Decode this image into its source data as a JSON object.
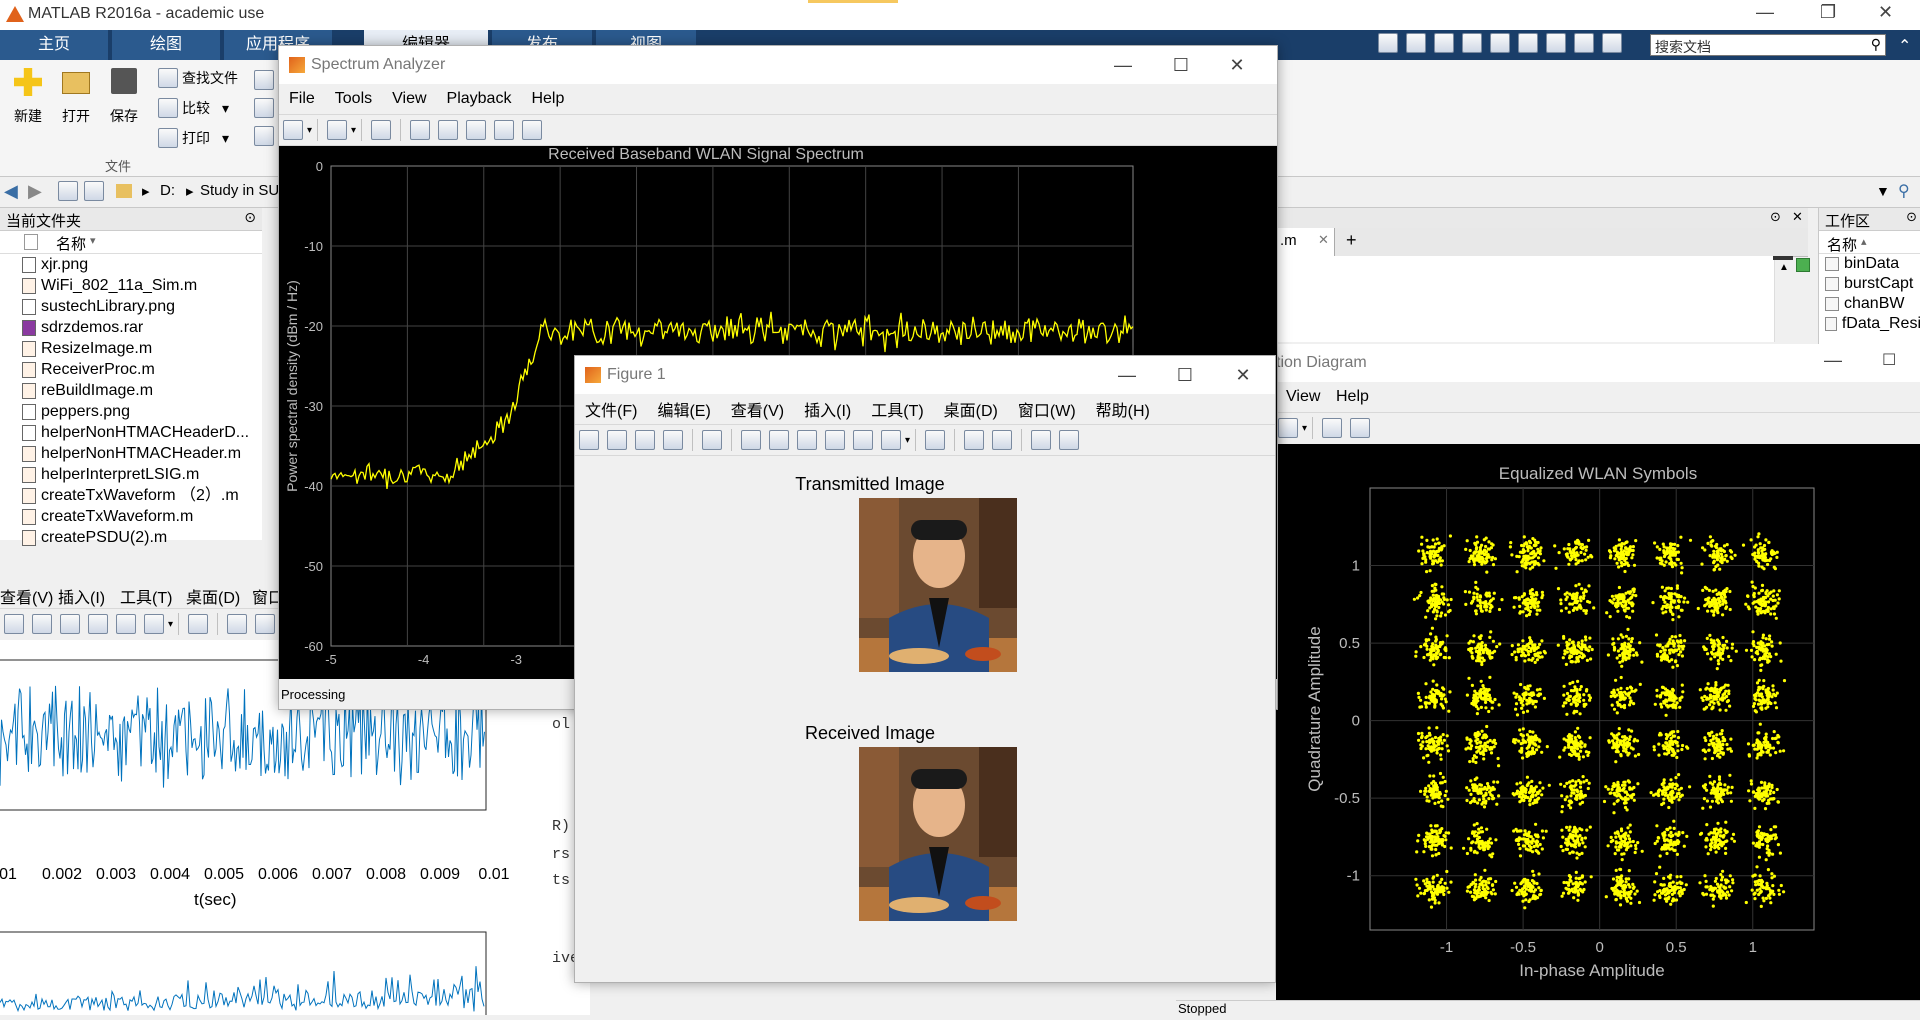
{
  "app": {
    "title": "MATLAB R2016a - academic use",
    "tabs": [
      "主页",
      "绘图",
      "应用程序",
      "编辑器",
      "发布",
      "视图"
    ],
    "search_placeholder": "搜索文档",
    "file_buttons": {
      "new": "新建",
      "open": "打开",
      "save": "保存",
      "find_files": "查找文件",
      "compare": "比较",
      "print": "打印",
      "section": "文件"
    },
    "path": {
      "drive": "D:",
      "folder": "Study in SU"
    },
    "current_folder": {
      "title": "当前文件夹",
      "column": "名称",
      "files": [
        "xjr.png",
        "WiFi_802_11a_Sim.m",
        "sustechLibrary.png",
        "sdrzdemos.rar",
        "ResizeImage.m",
        "ReceiverProc.m",
        "reBuildImage.m",
        "peppers.png",
        "helperNonHTMACHeaderD...",
        "helperNonHTMACHeader.m",
        "helperInterpretLSIG.m",
        "createTxWaveform （2）.m",
        "createTxWaveform.m",
        "createPSDU(2).m"
      ]
    },
    "workspace": {
      "title": "工作区",
      "column": "名称",
      "vars": [
        "binData",
        "burstCapt",
        "chanBW",
        "fData_Resi"
      ]
    },
    "editor_tab": ".m"
  },
  "bg_figure": {
    "menu": [
      "查看(V)",
      "插入(I)",
      "工具(T)",
      "桌面(D)",
      "窗口"
    ],
    "xticks": [
      "01",
      "0.002",
      "0.003",
      "0.004",
      "0.005",
      "0.006",
      "0.007",
      "0.008",
      "0.009",
      "0.01"
    ],
    "xlabel": "t(sec)"
  },
  "cmd_fragments": [
    "ol",
    "R)",
    "rs",
    "ts",
    "ive"
  ],
  "spectrum": {
    "title": "Spectrum Analyzer",
    "menu": [
      "File",
      "Tools",
      "View",
      "Playback",
      "Help"
    ],
    "plot_title": "Received Baseband WLAN Signal Spectrum",
    "ylabel": "Power spectral density (dBm / Hz)",
    "yticks": [
      "0",
      "-10",
      "-20",
      "-30",
      "-40",
      "-50",
      "-60"
    ],
    "xticks": [
      "-5",
      "-4",
      "-3"
    ],
    "status": "Processing",
    "colors": {
      "trace": "#ffff00",
      "bg": "#000000"
    }
  },
  "figure1": {
    "title": "Figure 1",
    "menu": [
      "文件(F)",
      "编辑(E)",
      "查看(V)",
      "插入(I)",
      "工具(T)",
      "桌面(D)",
      "窗口(W)",
      "帮助(H)"
    ],
    "tx_title": "Transmitted Image",
    "rx_title": "Received Image"
  },
  "constellation": {
    "title_fragment": "tion Diagram",
    "menu": [
      "View",
      "Help"
    ],
    "status": "Stopped"
  },
  "chart_data": {
    "type": "scatter",
    "title": "Equalized WLAN Symbols",
    "xlabel": "In-phase Amplitude",
    "ylabel": "Quadrature Amplitude",
    "xticks": [
      "-1",
      "-0.5",
      "0",
      "0.5",
      "1"
    ],
    "yticks": [
      "1",
      "0.5",
      "0",
      "-0.5",
      "-1"
    ],
    "xlim": [
      -1.5,
      1.4
    ],
    "ylim": [
      -1.35,
      1.5
    ],
    "point_color": "#ffff00",
    "distribution": "dense noisy QAM cloud filling approx -1.3..1.3 on both axes"
  }
}
